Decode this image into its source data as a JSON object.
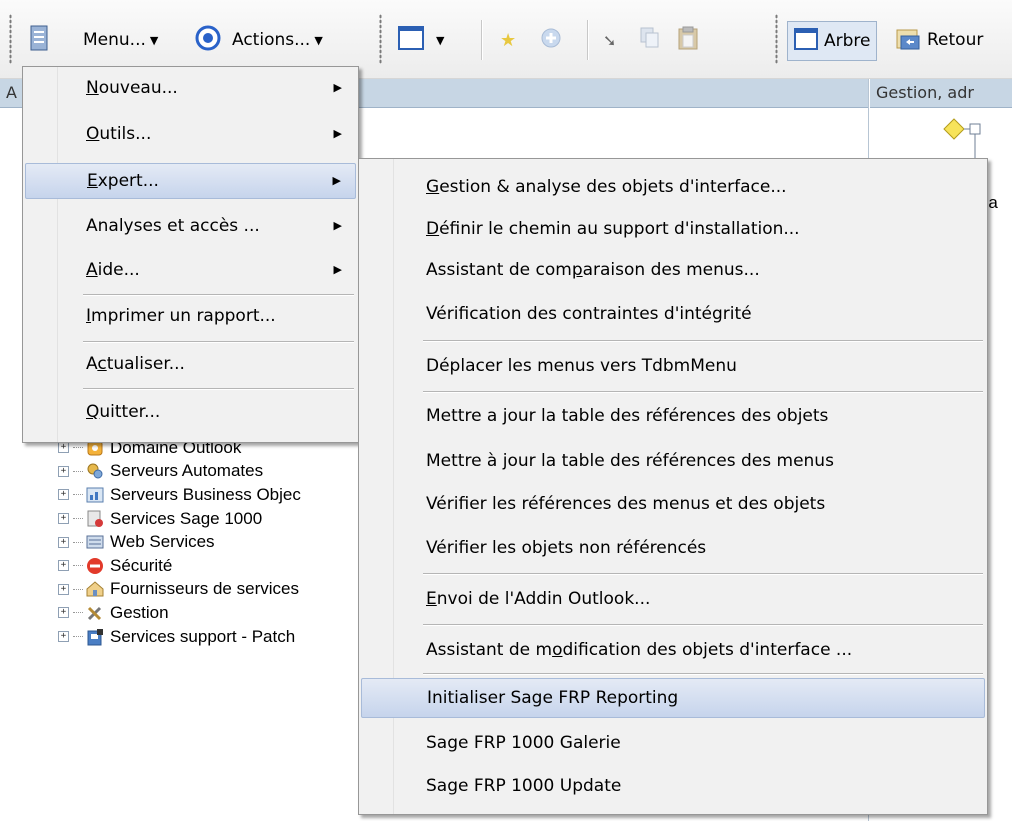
{
  "toolbar": {
    "menu_label": "Menu...",
    "actions_label": "Actions...",
    "tree_label": "Arbre",
    "back_label": "Retour"
  },
  "left_panel": {
    "header_text": "A"
  },
  "right_panel": {
    "header_text": "Gestion, adr",
    "partial_text": "Sa"
  },
  "tree": {
    "items": [
      {
        "label": "Domaine Outlook",
        "icon": "outlook-domain-icon"
      },
      {
        "label": "Serveurs Automates",
        "icon": "automation-server-icon"
      },
      {
        "label": "Serveurs Business Objec",
        "icon": "business-objects-icon"
      },
      {
        "label": "Services Sage 1000",
        "icon": "sage-services-icon"
      },
      {
        "label": "Web Services",
        "icon": "web-services-icon"
      },
      {
        "label": "Sécurité",
        "icon": "security-icon"
      },
      {
        "label": "Fournisseurs de services",
        "icon": "service-providers-icon"
      },
      {
        "label": "Gestion",
        "icon": "tools-icon"
      },
      {
        "label": "Services support - Patch",
        "icon": "support-patch-icon"
      }
    ]
  },
  "main_menu": {
    "items": [
      {
        "label": "Nouveau...",
        "mnemonic": "N",
        "rest": "ouveau..."
      },
      {
        "label": "Outils...",
        "mnemonic": "O",
        "rest": "utils..."
      },
      {
        "label": "Expert...",
        "mnemonic": "E",
        "rest": "xpert..."
      },
      {
        "label": "Analyses et accès ..."
      },
      {
        "label": "Aide...",
        "mnemonic": "A",
        "rest": "ide..."
      },
      {
        "label": "Imprimer un rapport...",
        "mnemonic": "I",
        "rest": "mprimer un rapport..."
      },
      {
        "label": "Actualiser...",
        "pre": "A",
        "mnemonic": "c",
        "rest": "tualiser..."
      },
      {
        "label": "Quitter...",
        "mnemonic": "Q",
        "rest": "uitter..."
      }
    ]
  },
  "expert_submenu": {
    "items": [
      {
        "pre": "",
        "mnemonic": "G",
        "rest": "estion & analyse des objets d'interface..."
      },
      {
        "pre": "",
        "mnemonic": "D",
        "rest": "éfinir le chemin au support d'installation..."
      },
      {
        "pre": "Assistant de com",
        "mnemonic": "p",
        "rest": "araison des menus..."
      },
      {
        "label": "Vérification des contraintes d'intégrité"
      },
      {
        "label": "Déplacer les menus vers TdbmMenu"
      },
      {
        "label": "Mettre a jour la table des références des objets"
      },
      {
        "label": "Mettre à jour la table des références des menus"
      },
      {
        "label": "Vérifier les références des menus et des objets"
      },
      {
        "label": "Vérifier les objets non référencés"
      },
      {
        "pre": "",
        "mnemonic": "E",
        "rest": "nvoi de l'Addin Outlook..."
      },
      {
        "pre": "Assistant de m",
        "mnemonic": "o",
        "rest": "dification des objets d'interface ..."
      },
      {
        "label": "Initialiser Sage FRP Reporting"
      },
      {
        "label": "Sage FRP 1000 Galerie"
      },
      {
        "label": "Sage FRP 1000 Update"
      }
    ]
  }
}
